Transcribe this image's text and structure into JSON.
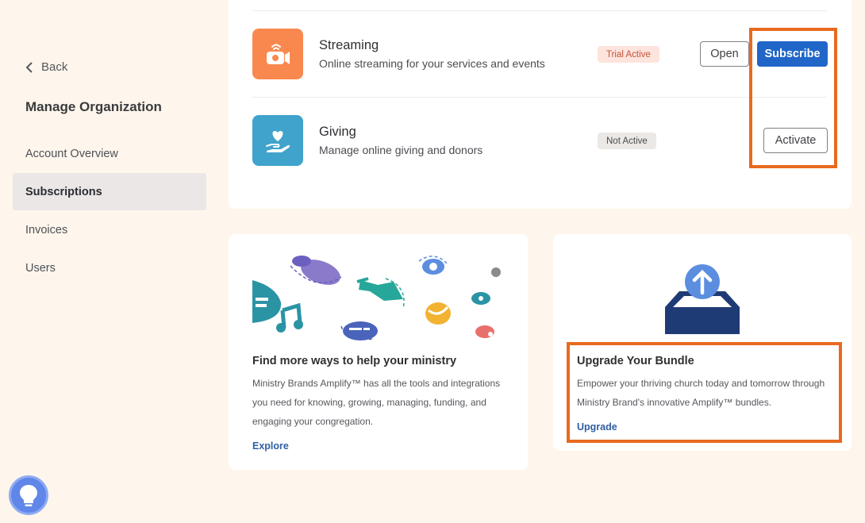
{
  "sidebar": {
    "back_label": "Back",
    "title": "Manage Organization",
    "items": [
      {
        "label": "Account Overview"
      },
      {
        "label": "Subscriptions"
      },
      {
        "label": "Invoices"
      },
      {
        "label": "Users"
      }
    ]
  },
  "apps": {
    "streaming": {
      "name": "Streaming",
      "description": "Online streaming for your services and events",
      "status": "Trial Active",
      "open_label": "Open",
      "subscribe_label": "Subscribe",
      "icon": "video-camera-icon",
      "color": "#f9884e"
    },
    "giving": {
      "name": "Giving",
      "description": "Manage online giving and donors",
      "status": "Not Active",
      "activate_label": "Activate",
      "icon": "heart-hand-icon",
      "color": "#3fa3cc"
    }
  },
  "promo": {
    "title": "Find more ways to help your ministry",
    "lines": [
      "Ministry Brands Amplify™ has all the tools and integrations",
      "you need for knowing, growing, managing, funding, and",
      "engaging your congregation."
    ],
    "link": "Explore"
  },
  "upgrade": {
    "title": "Upgrade Your Bundle",
    "lines": [
      "Empower your thriving church today and tomorrow through",
      "Ministry Brand's innovative Amplify™ bundles."
    ],
    "link": "Upgrade"
  },
  "colors": {
    "accent": "#2066c9",
    "highlight": "#e86a1f",
    "background": "#fef6ec"
  }
}
